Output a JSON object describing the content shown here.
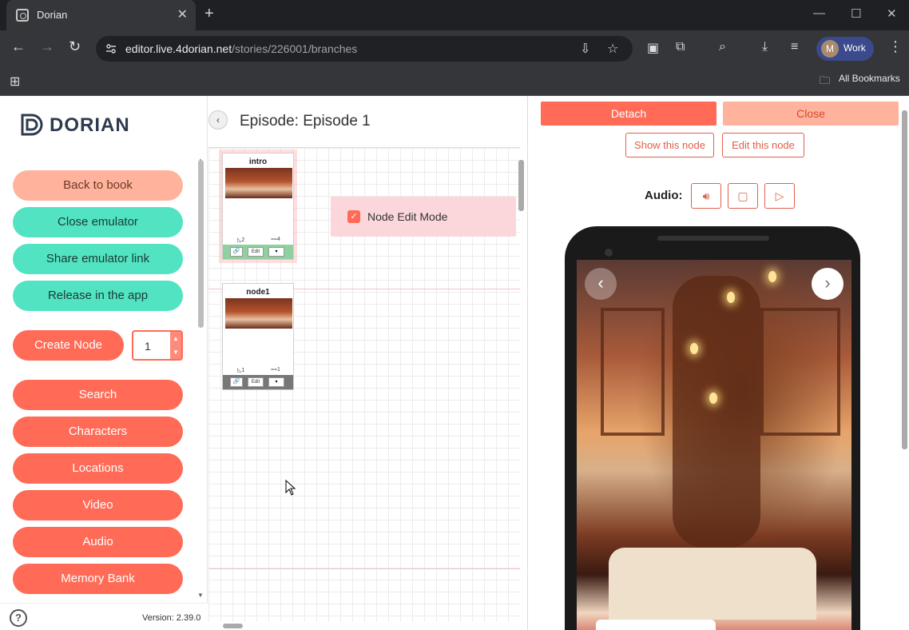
{
  "browser": {
    "tab_title": "Dorian",
    "url_host": "editor.live.4dorian.net",
    "url_path": "/stories/226001/branches",
    "profile_initial": "M",
    "profile_label": "Work",
    "bookmarks_label": "All Bookmarks"
  },
  "sidebar": {
    "logo_text": "DORIAN",
    "buttons": {
      "back": "Back to book",
      "close_emulator": "Close emulator",
      "share": "Share emulator link",
      "release": "Release in the app",
      "create_node": "Create Node",
      "search": "Search",
      "characters": "Characters",
      "locations": "Locations",
      "video": "Video",
      "audio": "Audio",
      "memory_bank": "Memory Bank"
    },
    "node_count": "1",
    "version": "Version: 2.39.0"
  },
  "editor": {
    "episode_title": "Episode: Episode 1",
    "edit_mode_label": "Node Edit Mode",
    "edit_mode_checked": true,
    "nodes": [
      {
        "title": "intro",
        "meta_a": "2",
        "meta_b": "4",
        "edit": "Edit"
      },
      {
        "title": "node1",
        "meta_a": "1",
        "meta_b": "1",
        "edit": "Edit"
      }
    ]
  },
  "emulator": {
    "detach": "Detach",
    "close": "Close",
    "show_node": "Show this node",
    "edit_node": "Edit this node",
    "audio_label": "Audio:"
  },
  "colors": {
    "coral": "#ff6b57",
    "peach": "#ffb39c",
    "teal": "#52e3c2"
  }
}
